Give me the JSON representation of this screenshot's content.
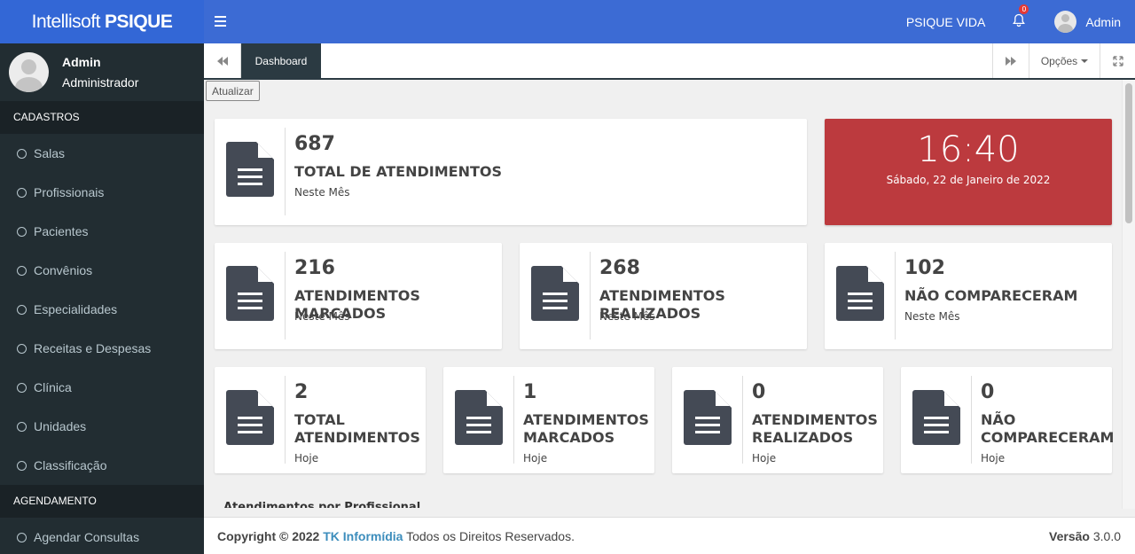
{
  "header": {
    "brand_light": "Intellisoft",
    "brand_bold": "PSIQUE",
    "company": "PSIQUE VIDA",
    "notifications_count": "0",
    "user_name": "Admin"
  },
  "sidebar": {
    "user_name": "Admin",
    "user_role": "Administrador",
    "section_cadastros": "CADASTROS",
    "items": [
      "Salas",
      "Profissionais",
      "Pacientes",
      "Convênios",
      "Especialidades",
      "Receitas e Despesas",
      "Clínica",
      "Unidades",
      "Classificação"
    ],
    "section_agendamento": "AGENDAMENTO",
    "agendamento_items": [
      "Agendar Consultas"
    ]
  },
  "tabs": {
    "active": "Dashboard",
    "opcoes": "Opções"
  },
  "refresh_label": "Atualizar",
  "dashboard": {
    "month_total": {
      "value": "687",
      "label": "TOTAL DE ATENDIMENTOS",
      "period": "Neste Mês"
    },
    "clock": {
      "time": "16:40",
      "date": "Sábado, 22 de Janeiro de 2022"
    },
    "month_stats": [
      {
        "value": "216",
        "label": "ATENDIMENTOS MARCADOS",
        "period": "Neste Mês"
      },
      {
        "value": "268",
        "label": "ATENDIMENTOS REALIZADOS",
        "period": "Neste Mês"
      },
      {
        "value": "102",
        "label": "NÃO COMPARECERAM",
        "period": "Neste Mês"
      }
    ],
    "today_stats": [
      {
        "value": "2",
        "label_l1": "TOTAL",
        "label_l2": "ATENDIMENTOS",
        "period": "Hoje"
      },
      {
        "value": "1",
        "label_l1": "ATENDIMENTOS",
        "label_l2": "MARCADOS",
        "period": "Hoje"
      },
      {
        "value": "0",
        "label_l1": "ATENDIMENTOS",
        "label_l2": "REALIZADOS",
        "period": "Hoje"
      },
      {
        "value": "0",
        "label_l1": "NÃO",
        "label_l2": "COMPARECERAM",
        "period": "Hoje"
      }
    ],
    "next_section_title": "Atendimentos por Profissional"
  },
  "footer": {
    "copyright": "Copyright © 2022",
    "company_link": "TK Informídia",
    "rights": "Todos os Direitos Reservados.",
    "version_label": "Versão",
    "version": "3.0.0"
  },
  "colors": {
    "topbar": "#3c6bd4",
    "sidebar": "#222d32",
    "clock_bg": "#bc3a3e",
    "link": "#3c8dbc"
  }
}
